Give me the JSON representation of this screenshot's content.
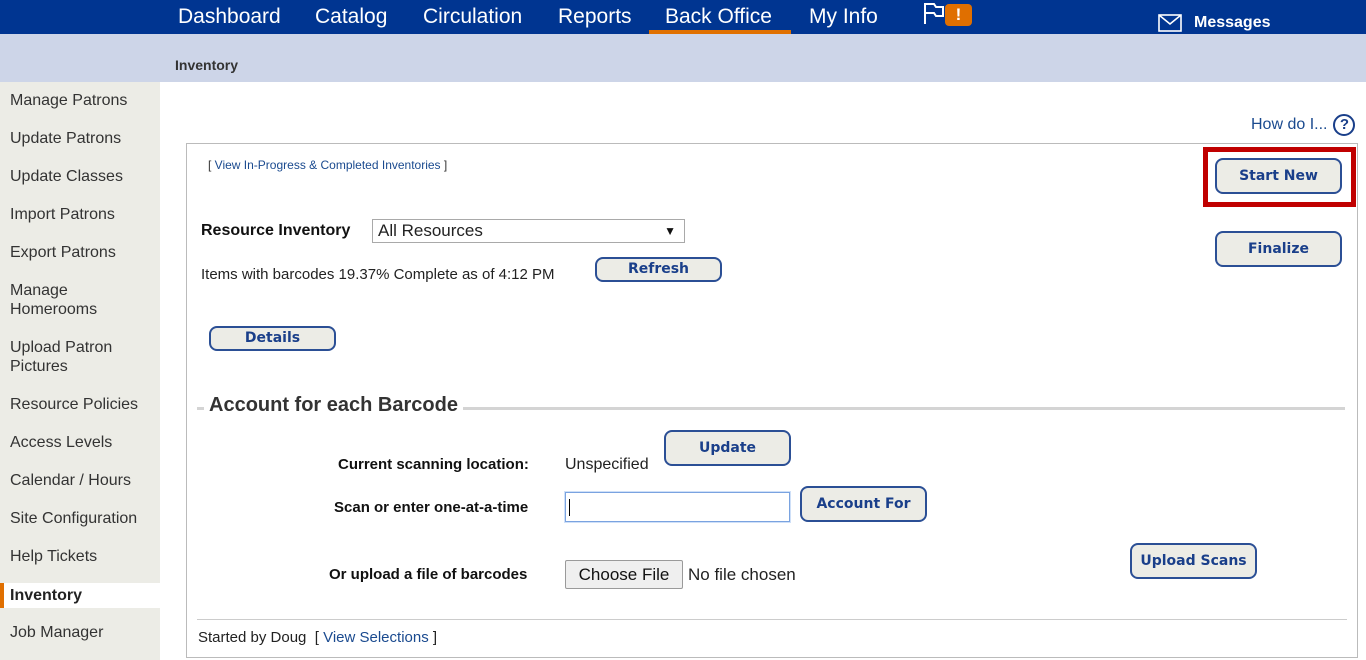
{
  "topnav": {
    "tabs": [
      {
        "label": "Dashboard",
        "active": false
      },
      {
        "label": "Catalog",
        "active": false
      },
      {
        "label": "Circulation",
        "active": false
      },
      {
        "label": "Reports",
        "active": false
      },
      {
        "label": "Back Office",
        "active": true
      },
      {
        "label": "My Info",
        "active": false
      }
    ],
    "alert_icon": "flag-icon",
    "alert_badge": "!",
    "messages_icon": "envelope-icon",
    "messages_label": "Messages"
  },
  "subheader": {
    "breadcrumb": "Inventory"
  },
  "sidebar": {
    "items": [
      {
        "label": "Manage Patrons"
      },
      {
        "label": "Update Patrons"
      },
      {
        "label": "Update Classes"
      },
      {
        "label": "Import Patrons"
      },
      {
        "label": "Export Patrons"
      },
      {
        "label": "Manage Homerooms"
      },
      {
        "label": "Upload Patron Pictures"
      },
      {
        "label": "Resource Policies"
      },
      {
        "label": "Access Levels"
      },
      {
        "label": "Calendar / Hours"
      },
      {
        "label": "Site Configuration"
      },
      {
        "label": "Help Tickets"
      },
      {
        "label": "Inventory",
        "active": true
      },
      {
        "label": "Job Manager"
      }
    ]
  },
  "help": {
    "label": "How do I...",
    "icon": "?"
  },
  "panel": {
    "view_link_open": "[ ",
    "view_link": "View In-Progress & Completed Inventories",
    "view_link_close": " ]",
    "start_new": "Start New",
    "finalize": "Finalize",
    "resource_inventory_label": "Resource Inventory",
    "resource_inventory_value": "All Resources",
    "status_text": "Items with barcodes 19.37% Complete as of 4:12 PM",
    "refresh": "Refresh",
    "details": "Details",
    "section_title": "Account for each Barcode",
    "scan_location_label": "Current scanning location:",
    "scan_location_value": "Unspecified",
    "update": "Update",
    "scan_label": "Scan or enter one-at-a-time",
    "scan_value": "",
    "account_for": "Account For",
    "upload_label": "Or upload a file of barcodes",
    "choose_file": "Choose File",
    "no_file": "No file chosen",
    "upload_scans": "Upload Scans",
    "started_by": "Started by Doug",
    "view_selections_open": "[ ",
    "view_selections": "View Selections",
    "view_selections_close": " ]"
  },
  "colors": {
    "nav_bg": "#003591",
    "accent": "#e06f00",
    "subheader_bg": "#cdd5e8",
    "sidebar_bg": "#ecece6",
    "highlight": "#c00000",
    "button_text": "#1a3f8a"
  }
}
